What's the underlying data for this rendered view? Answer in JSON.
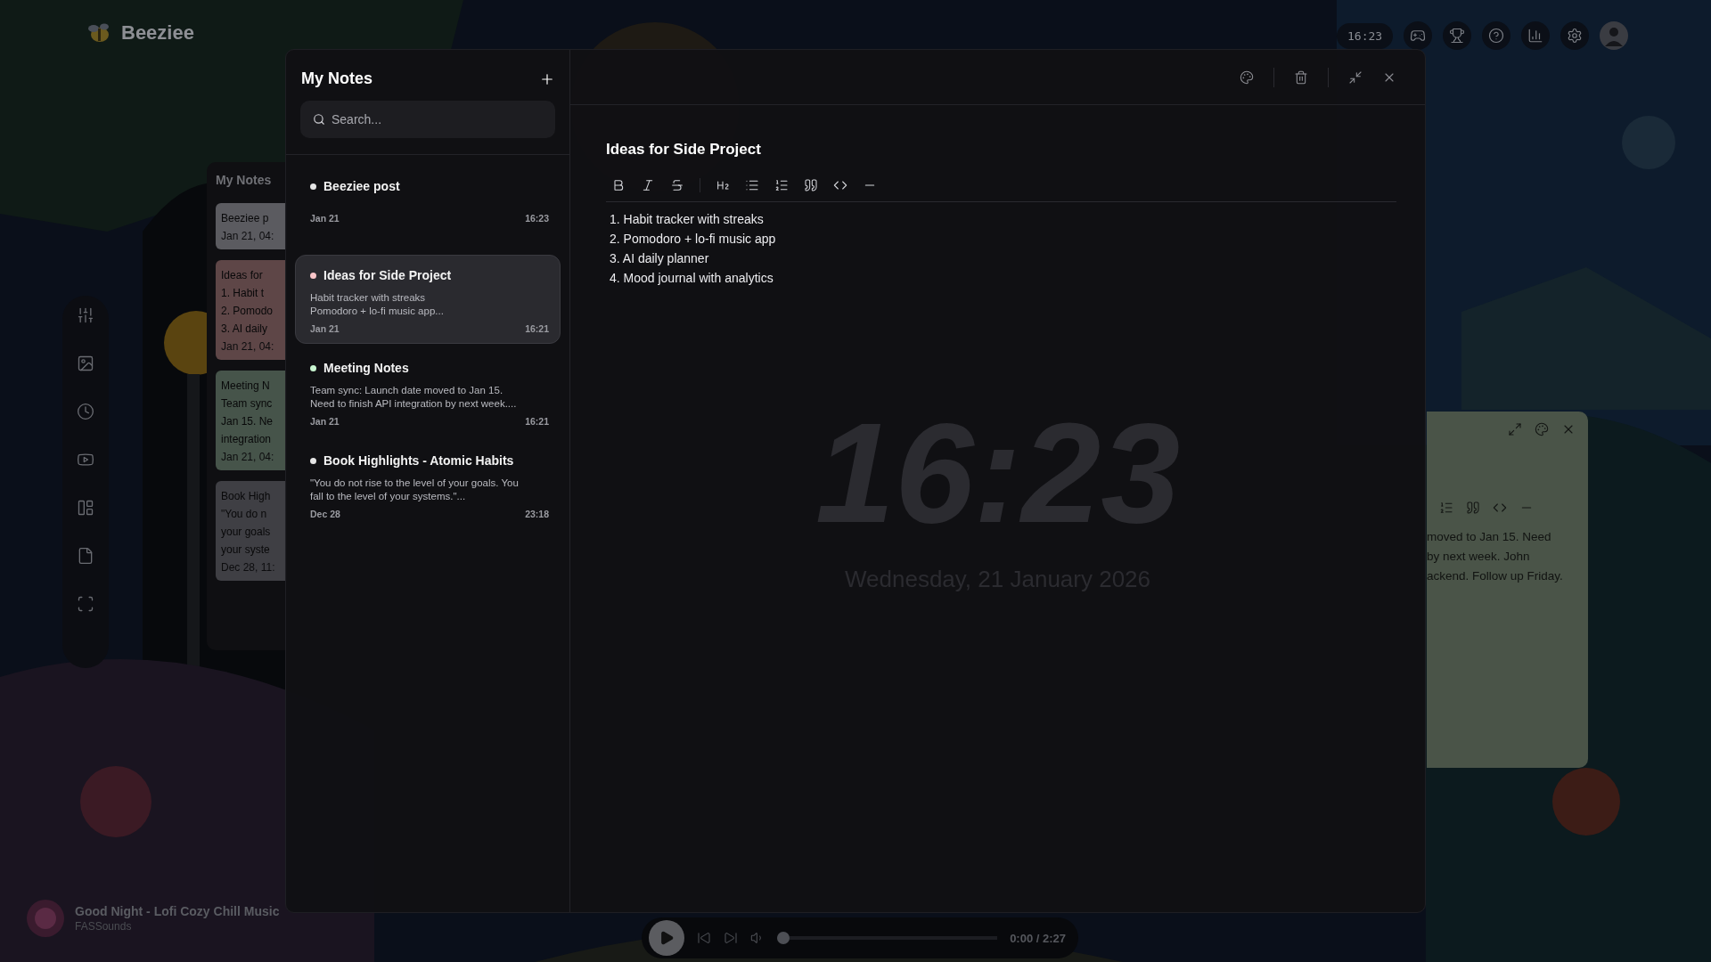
{
  "brand": {
    "name": "Beeziee"
  },
  "top_bar": {
    "clock": "16:23"
  },
  "back_panel": {
    "title": "My Notes",
    "cards": [
      {
        "title": "Beeziee p",
        "date": "Jan 21, 04:",
        "color": "#5b5b60"
      },
      {
        "title": "Ideas for",
        "lines": [
          "1. Habit t",
          "2. Pomodo",
          "3. AI daily"
        ],
        "date": "Jan 21, 04:",
        "color": "#5e4647"
      },
      {
        "title": "Meeting N",
        "lines": [
          "Team sync",
          "Jan 15. Ne",
          "integration"
        ],
        "date": "Jan 21, 04:",
        "color": "#46544a"
      },
      {
        "title": "Book High",
        "lines": [
          "\"You do n",
          "your goals",
          "your syste"
        ],
        "date": "Dec 28, 11:",
        "color": "#3f3f44"
      }
    ]
  },
  "notes_window": {
    "title": "My Notes",
    "search": {
      "placeholder": "Search..."
    },
    "items": [
      {
        "title": "Beeziee post",
        "color": "#e5e5e5",
        "date": "Jan 21",
        "time": "16:23",
        "selected": false
      },
      {
        "title": "Ideas for Side Project",
        "color": "#f9c5c9",
        "preview": [
          "Habit tracker with streaks",
          "Pomodoro + lo-fi music app..."
        ],
        "date": "Jan 21",
        "time": "16:21",
        "selected": true
      },
      {
        "title": "Meeting Notes",
        "color": "#c8f5d0",
        "preview": [
          "Team sync: Launch date moved to Jan 15.",
          "Need to finish API integration by next week...."
        ],
        "date": "Jan 21",
        "time": "16:21",
        "selected": false
      },
      {
        "title": "Book Highlights - Atomic Habits",
        "color": "#e5e5e5",
        "preview": [
          "\"You do not rise to the level of your goals. You",
          "fall to the level of your systems.\"..."
        ],
        "date": "Dec 28",
        "time": "23:18",
        "selected": false
      }
    ],
    "editor": {
      "title": "Ideas for Side Project",
      "lines": [
        "1. Habit tracker with streaks",
        "2. Pomodoro + lo-fi music app",
        "3. AI daily planner",
        "4. Mood journal with analytics"
      ]
    }
  },
  "desktop_clock": {
    "time": "16:23",
    "date": "Wednesday, 21 January 2026"
  },
  "sticky_note": {
    "lines": [
      "moved to Jan 15. Need",
      "by next week. John",
      "ackend. Follow up Friday."
    ]
  },
  "player": {
    "title": "Good Night - Lofi Cozy Chill Music",
    "artist": "FASSounds",
    "time": "0:00 / 2:27",
    "level": 0
  }
}
